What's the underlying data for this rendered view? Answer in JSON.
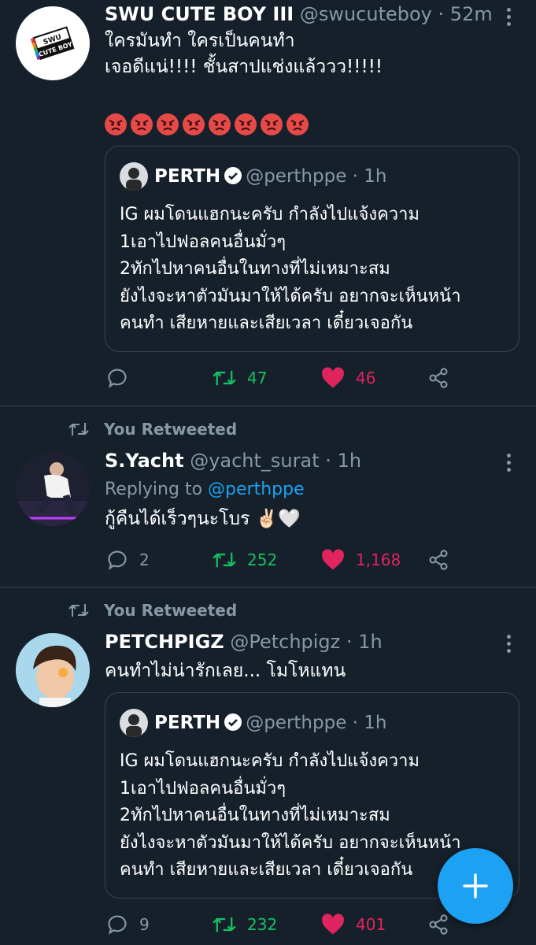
{
  "tweets": [
    {
      "name": "SWU CUTE BOY III",
      "handle": "@swucuteboy",
      "dot": "·",
      "time": "52m",
      "text_lines": [
        "ใครมันทำ ใครเป็นคนทำ",
        "เจอดีแน่!!!! ชั้นสาปแช่งแล้ววว!!!!!"
      ],
      "emoji_count": 8,
      "quote": {
        "name": "PERTH",
        "handle": "@perthppe",
        "dot": "·",
        "time": "1h",
        "lines": [
          "IG ผมโดนแฮกนะครับ กำลังไปแจ้งความ",
          "1เอาไปฟอลคนอื่นมั่วๆ",
          "2ทักไปหาคนอื่นในทางที่ไม่เหมาะสม",
          "ยังไงจะหาตัวมันมาให้ได้ครับ อยากจะเห็นหน้า",
          "คนทำ เสียหายและเสียเวลา เดี๋ยวเจอกัน"
        ]
      },
      "replies": "",
      "retweets": "47",
      "likes": "46"
    },
    {
      "retweeted_label": "You Retweeted",
      "name": "S.Yacht",
      "handle": "@yacht_surat",
      "dot": "·",
      "time": "1h",
      "replying_label": "Replying to",
      "replying_to": "@perthppe",
      "text": "กู้คืนได้เร็วๆนะโบร ✌🏻🤍",
      "replies": "2",
      "retweets": "252",
      "likes": "1,168"
    },
    {
      "retweeted_label": "You Retweeted",
      "name": "PETCHPIGZ",
      "handle": "@Petchpigz",
      "dot": "·",
      "time": "1h",
      "text": "คนทำไม่น่ารักเลย... โมโหแทน",
      "quote": {
        "name": "PERTH",
        "handle": "@perthppe",
        "dot": "·",
        "time": "1h",
        "lines": [
          "IG ผมโดนแฮกนะครับ กำลังไปแจ้งความ",
          "1เอาไปฟอลคนอื่นมั่วๆ",
          "2ทักไปหาคนอื่นในทางที่ไม่เหมาะสม",
          "ยังไงจะหาตัวมันมาให้ได้ครับ อยากจะเห็นหน้า",
          "คนทำ เสียหายและเสียเวลา เดี๋ยวเจอกัน"
        ]
      },
      "replies": "9",
      "retweets": "232",
      "likes": "401"
    }
  ],
  "avatar_logo_text": [
    "SWU",
    "CUTE BOY"
  ],
  "colors": {
    "background": "#15202b",
    "divider": "#38444d",
    "secondary_text": "#8899a6",
    "retweet_green": "#17bf63",
    "like_pink": "#e0245e",
    "link_blue": "#1da1f2"
  },
  "icons": {
    "reply": "reply-icon",
    "retweet": "retweet-icon",
    "like": "heart-icon",
    "share": "share-icon",
    "more": "more-vertical-icon",
    "verified": "verified-badge-icon",
    "compose": "compose-plus-icon"
  }
}
